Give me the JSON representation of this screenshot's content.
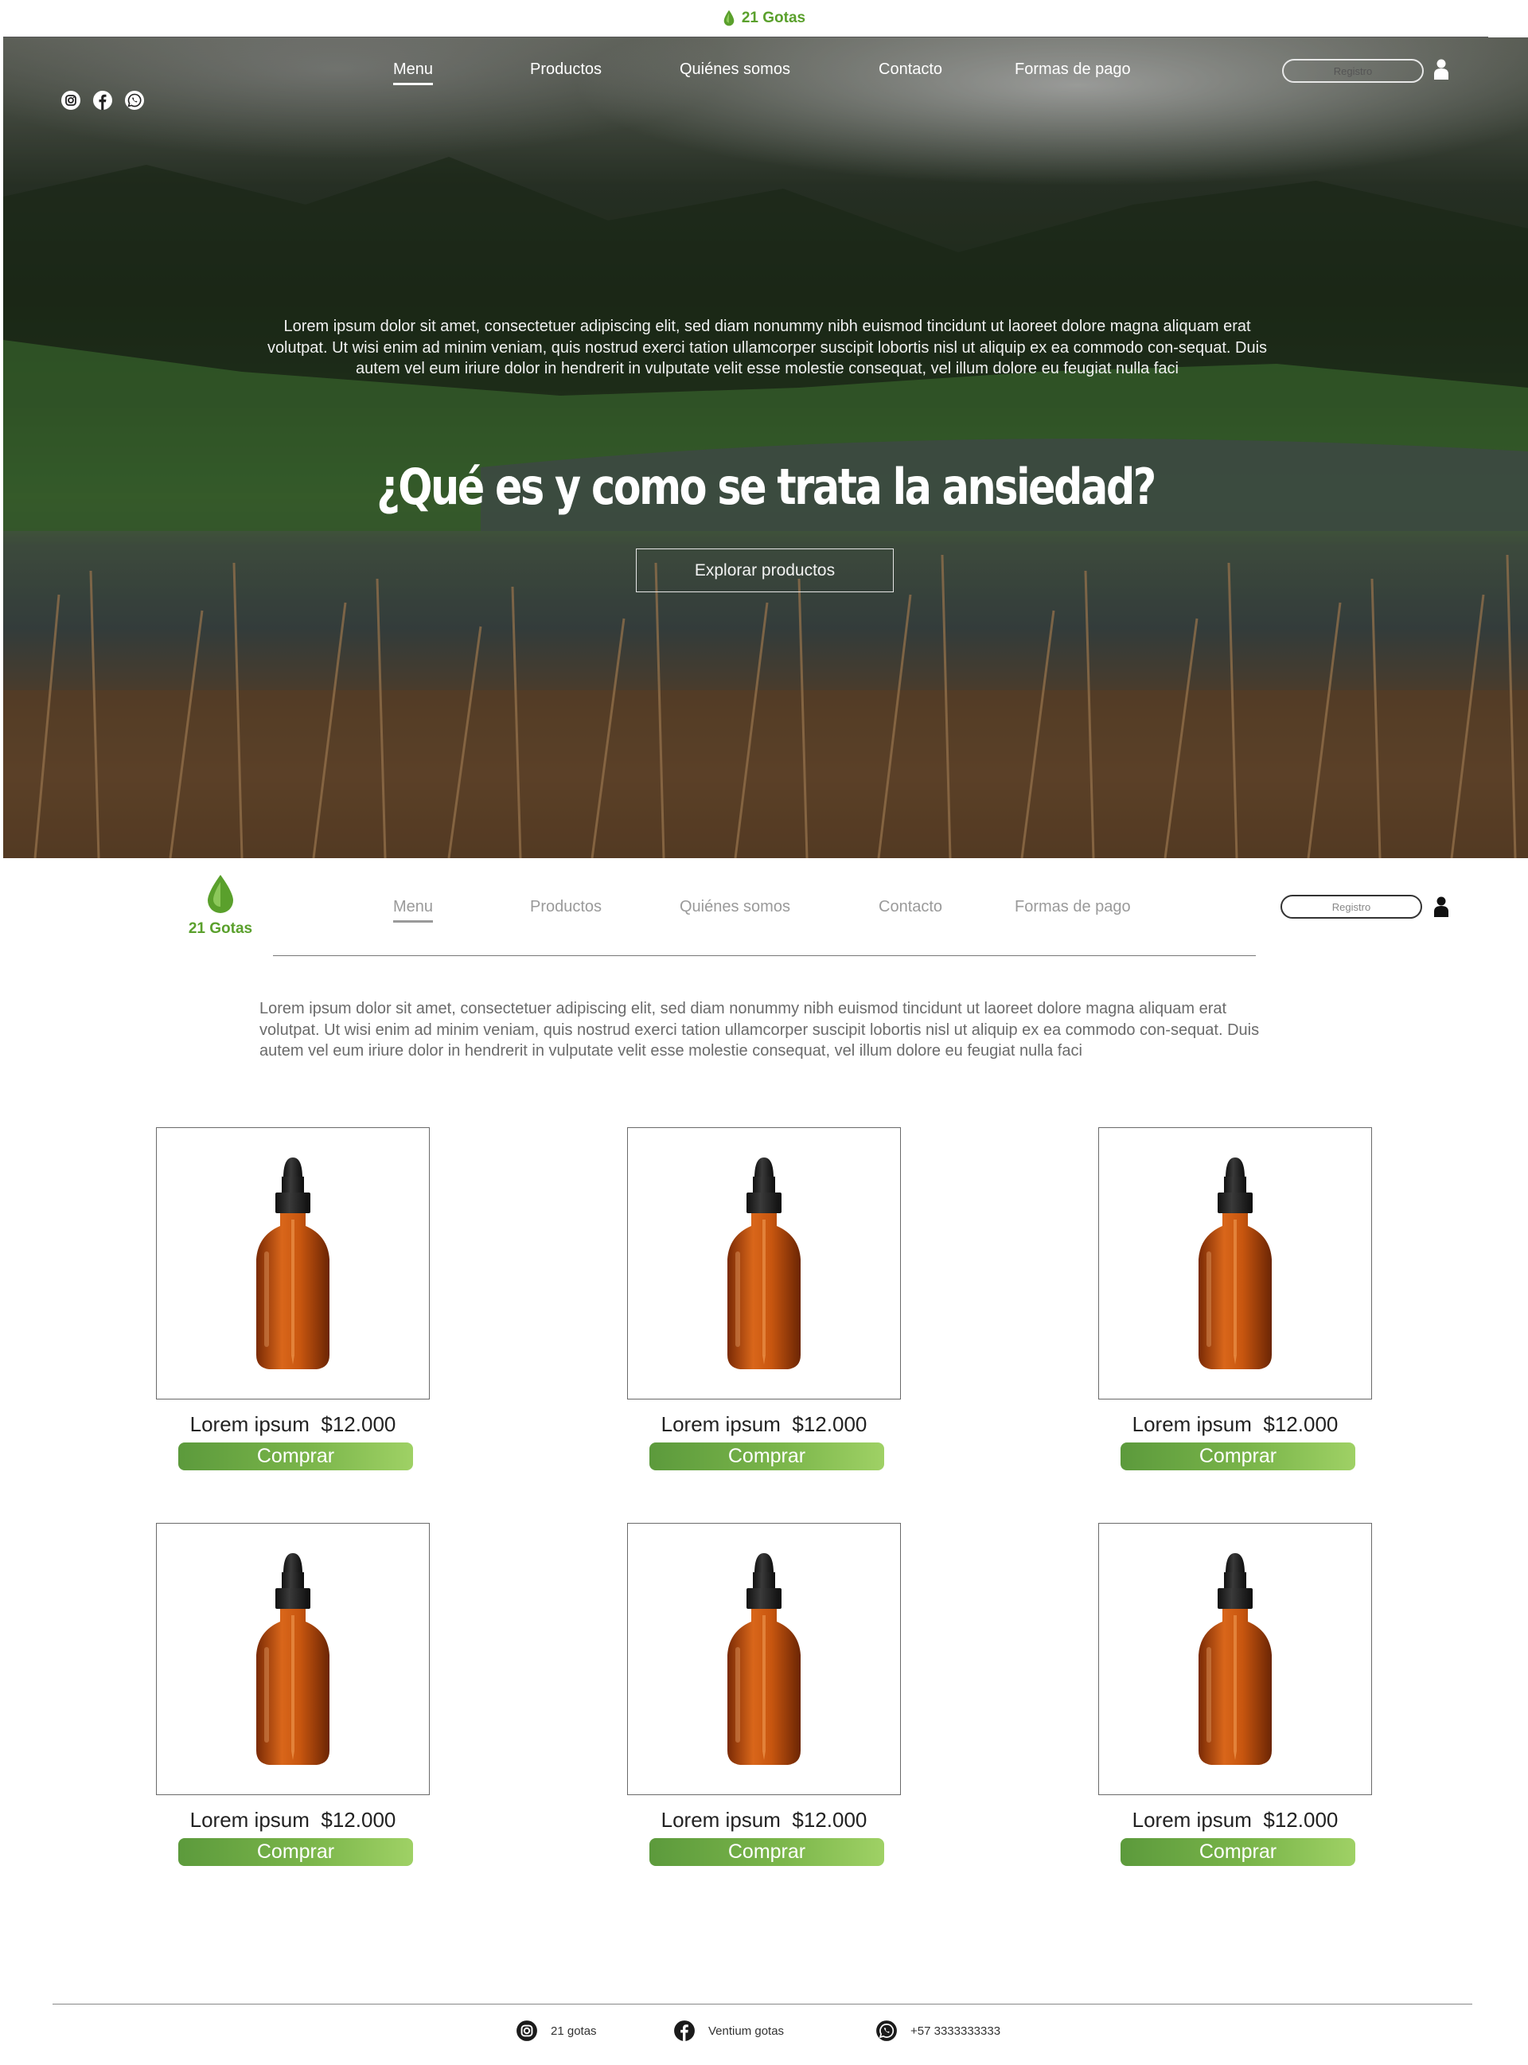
{
  "brand": {
    "name": "21 Gotas",
    "color": "#5aa02c"
  },
  "icons": {
    "drop": "drop-icon",
    "instagram": "instagram-icon",
    "facebook": "facebook-icon",
    "whatsapp": "whatsapp-icon",
    "user": "user-icon"
  },
  "nav": {
    "items": [
      {
        "label": "Menu",
        "active": true
      },
      {
        "label": "Productos",
        "active": false
      },
      {
        "label": "Quiénes somos",
        "active": false
      },
      {
        "label": "Contacto",
        "active": false
      },
      {
        "label": "Formas de pago",
        "active": false
      }
    ],
    "register_label": "Registro"
  },
  "hero": {
    "text": "Lorem ipsum dolor sit amet, consectetuer adipiscing elit, sed diam nonummy nibh euismod tincidunt ut laoreet dolore magna aliquam erat volutpat. Ut wisi enim ad minim veniam, quis nostrud exerci tation ullamcorper suscipit lobortis nisl ut aliquip ex ea commodo con-sequat. Duis autem vel eum iriure dolor in hendrerit in vulputate velit esse molestie consequat, vel illum dolore eu feugiat nulla faci",
    "title": "¿Qué es y como se trata la ansiedad?",
    "button_label": "Explorar productos"
  },
  "intro": {
    "text": "Lorem ipsum dolor sit amet, consectetuer adipiscing elit, sed diam nonummy nibh euismod tincidunt ut laoreet dolore magna aliquam erat volutpat. Ut wisi enim ad minim veniam, quis nostrud exerci tation ullamcorper suscipit lobortis nisl ut aliquip ex ea commodo con-sequat. Duis autem vel eum iriure dolor in hendrerit in vulputate velit esse molestie consequat, vel illum dolore eu feugiat nulla faci"
  },
  "products": [
    {
      "name": "Lorem ipsum",
      "price": "$12.000",
      "button": "Comprar"
    },
    {
      "name": "Lorem ipsum",
      "price": "$12.000",
      "button": "Comprar"
    },
    {
      "name": "Lorem ipsum",
      "price": "$12.000",
      "button": "Comprar"
    },
    {
      "name": "Lorem ipsum",
      "price": "$12.000",
      "button": "Comprar"
    },
    {
      "name": "Lorem ipsum",
      "price": "$12.000",
      "button": "Comprar"
    },
    {
      "name": "Lorem ipsum",
      "price": "$12.000",
      "button": "Comprar"
    }
  ],
  "footer": {
    "instagram": "21 gotas",
    "facebook": "Ventium gotas",
    "whatsapp": "+57 3333333333"
  },
  "colors": {
    "accent_green": "#5aa02c",
    "button_gradient_start": "#5c9a3c",
    "button_gradient_end": "#9fd165",
    "bottle_amber": "#c8560f"
  }
}
